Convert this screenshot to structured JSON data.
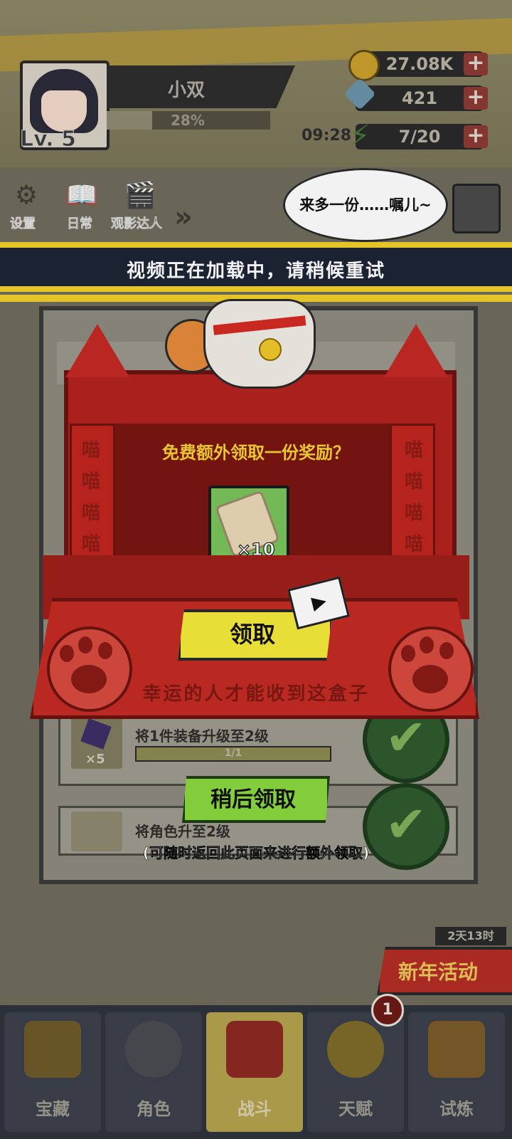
{
  "player": {
    "name": "小双",
    "exp_percent": "28%",
    "level": "Lv. 5"
  },
  "resources": [
    {
      "icon": "paw-coin-icon",
      "value": "27.08K"
    },
    {
      "icon": "diamond-icon",
      "value": "421"
    },
    {
      "icon": "energy-icon",
      "value": "7/20"
    }
  ],
  "energy_timer": "09:28",
  "plus_label": "+",
  "menu": [
    {
      "icon": "gear-icon",
      "label": "设置"
    },
    {
      "icon": "book-icon",
      "label": "日常"
    },
    {
      "icon": "clapper-icon",
      "label": "观影达人"
    }
  ],
  "speech_bubble": "来多一份……嘱儿~",
  "banner": "视频正在加载中，请稍候重试",
  "lucky_box": {
    "title": "免费额外领取一份奖励？",
    "reward_icon": "scroll-icon",
    "reward_qty": "×10",
    "claim_label": "领取",
    "side_text": [
      "喵",
      "喵",
      "喵",
      "喵"
    ],
    "caption": "幸运的人才能收到这盒子"
  },
  "tasks": [
    {
      "label": "将1件装备升级至2级",
      "progress": "1/1",
      "qty": "×5",
      "progress_fraction": 1.0
    },
    {
      "label": "将角色升至2级"
    }
  ],
  "later": {
    "label": "稍后领取",
    "note": "(可随时返回此页面来进行额外领取)"
  },
  "event": {
    "timer": "2天13时",
    "label": "新年活动"
  },
  "nav": [
    {
      "icon": "treasure-chest-icon",
      "label": "宝藏",
      "active": false
    },
    {
      "icon": "character-icon",
      "label": "角色",
      "active": false
    },
    {
      "icon": "swords-icon",
      "label": "战斗",
      "active": true
    },
    {
      "icon": "lightbulb-icon",
      "label": "天赋",
      "active": false
    },
    {
      "icon": "trial-emblem-icon",
      "label": "试炼",
      "active": false
    }
  ],
  "nav_badge": "1"
}
